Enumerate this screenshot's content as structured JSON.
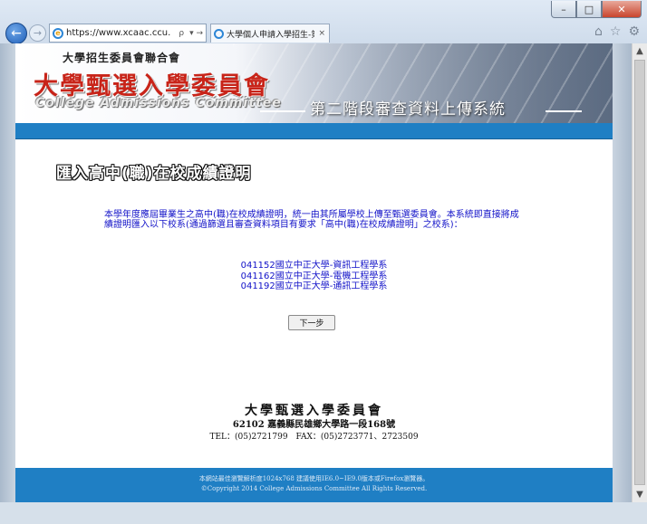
{
  "browser": {
    "url": "https://www.xcaac.ccu.",
    "search_glyph": "ρ",
    "address_controls": "▾ →",
    "tab_title": "大學個人申請入學招生-第...",
    "tab_close": "×",
    "min_glyph": "–",
    "max_glyph": "□",
    "close_glyph": "✕",
    "back_glyph": "←",
    "forward_glyph": "→",
    "home_glyph": "⌂",
    "favorites_glyph": "☆",
    "settings_glyph": "⚙"
  },
  "banner": {
    "top_line": "大學招生委員會聯合會",
    "main_title": "大學甄選入學委員會",
    "english": "College Admissions Committee",
    "system_name": "第二階段審查資料上傳系統"
  },
  "main": {
    "title": "匯入高中(職)在校成績證明",
    "intro": "本學年度應屆畢業生之高中(職)在校成績證明，統一由其所屬學校上傳至甄選委員會。本系統即直接將成績證明匯入以下校系(通過篩選且審查資料項目有要求「高中(職)在校成績證明」之校系)：",
    "departments": [
      "041152國立中正大學-資訊工程學系",
      "041162國立中正大學-電機工程學系",
      "041192國立中正大學-通訊工程學系"
    ],
    "next_button": "下一步"
  },
  "footer": {
    "org_name": "大學甄選入學委員會",
    "address": "62102 嘉義縣民雄鄉大學路一段168號",
    "contact": "TEL：(05)2721799　FAX：(05)2723771、2723509",
    "note": "本網站最佳瀏覽解析度1024x768 建議使用IE6.0~IE9.0版本或Firefox瀏覽器。",
    "copyright": "©Copyright 2014 College Admissions Committee All Rights Reserved."
  },
  "scrollbar": {
    "up_glyph": "▲",
    "down_glyph": "▼"
  }
}
